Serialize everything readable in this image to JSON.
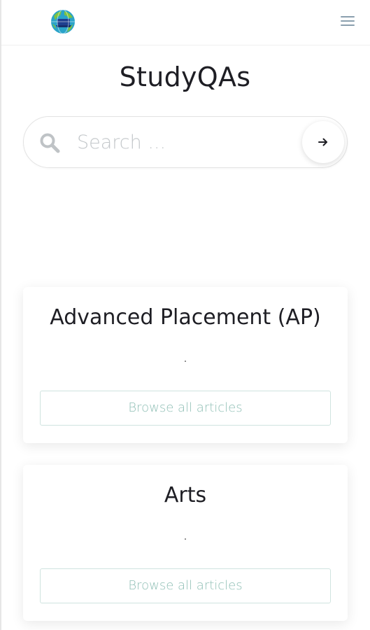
{
  "header": {
    "logo_icon": "globe-logo-icon",
    "menu_icon": "hamburger-menu-icon"
  },
  "site": {
    "title": "StudyQAs"
  },
  "search": {
    "placeholder": "Search ...",
    "value": "",
    "search_icon": "search-icon",
    "submit_icon": "arrow-right-icon"
  },
  "categories": [
    {
      "title": "Advanced Placement (AP)",
      "description": ".",
      "button_label": "Browse all articles"
    },
    {
      "title": "Arts",
      "description": ".",
      "button_label": "Browse all articles"
    }
  ],
  "colors": {
    "title_text": "#1e1e24",
    "button_text": "#8fbfb5",
    "button_border": "#cfe3df",
    "menu_icon": "#8a9fae",
    "placeholder": "#c3c7ca"
  }
}
